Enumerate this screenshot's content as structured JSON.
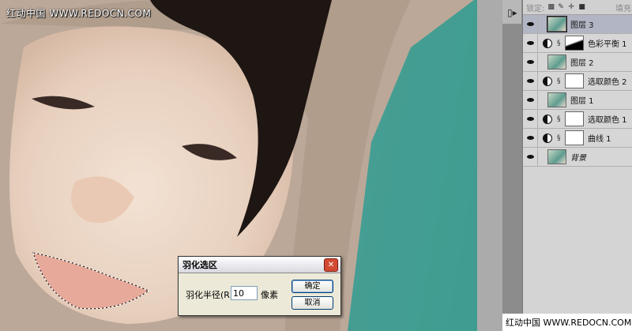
{
  "watermark": {
    "top": "红动中国 WWW.REDOCN.COM",
    "bottom": "红动中国 WWW.REDOCN.COM"
  },
  "layers_panel": {
    "lock_label": "锁定:",
    "fill_label": "填充",
    "layers": [
      {
        "name": "图层 3",
        "type": "pixel",
        "selected": true
      },
      {
        "name": "色彩平衡 1",
        "type": "adjustment"
      },
      {
        "name": "图层 2",
        "type": "pixel"
      },
      {
        "name": "选取颜色 2",
        "type": "adjustment"
      },
      {
        "name": "图层 1",
        "type": "pixel"
      },
      {
        "name": "选取颜色 1",
        "type": "adjustment"
      },
      {
        "name": "曲线 1",
        "type": "adjustment"
      },
      {
        "name": "背景",
        "type": "background"
      }
    ]
  },
  "dialog": {
    "title": "羽化选区",
    "radius_label": "羽化半径(R):",
    "radius_value": "10",
    "unit": "像素",
    "ok": "确定",
    "cancel": "取消",
    "close_glyph": "✕"
  },
  "icons": {
    "eye": "eye-icon",
    "adjustment": "adjustment-layer-icon",
    "link": "link-icon",
    "collapse": "panel-collapse-icon",
    "locks": [
      "lock-transparent-icon",
      "lock-paint-icon",
      "lock-move-icon",
      "lock-all-icon"
    ]
  }
}
